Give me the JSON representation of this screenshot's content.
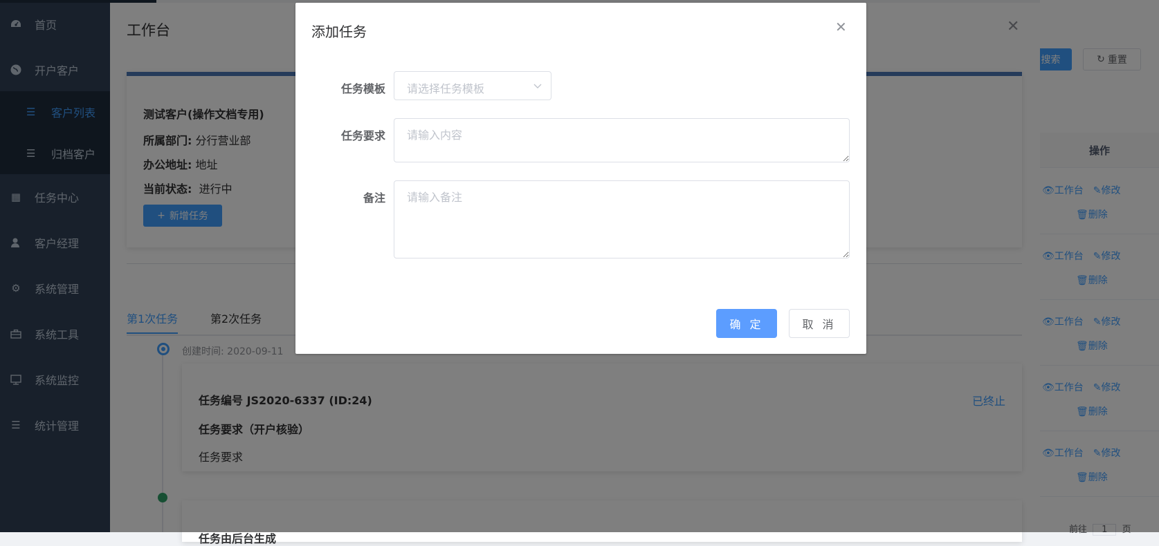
{
  "sidebar": {
    "items": [
      {
        "label": "首页",
        "icon": "dashboard-icon"
      },
      {
        "label": "开户客户",
        "icon": "globe-icon"
      },
      {
        "label": "任务中心",
        "icon": "grid-icon"
      },
      {
        "label": "客户经理",
        "icon": "user-icon"
      },
      {
        "label": "系统管理",
        "icon": "gear-icon"
      },
      {
        "label": "系统工具",
        "icon": "toolbox-icon"
      },
      {
        "label": "系统监控",
        "icon": "monitor-icon"
      },
      {
        "label": "统计管理",
        "icon": "list-icon"
      }
    ],
    "subitems": [
      {
        "label": "客户列表",
        "active": true
      },
      {
        "label": "归档客户",
        "active": false
      }
    ]
  },
  "background_page": {
    "search_label": "搜索",
    "reset_label": "重置",
    "table_header_ops": "操作",
    "row_actions": {
      "workbench": "工作台",
      "edit": "修改",
      "delete": "删除"
    },
    "pager_goto": "前往",
    "pager_value": "1",
    "pager_unit": "页"
  },
  "drawer": {
    "title": "工作台",
    "customer_name": "测试客户(操作文档专用)",
    "dept_label": "所属部门:",
    "dept_value": "分行营业部",
    "address_label": "办公地址:",
    "address_value": "地址",
    "status_label": "当前状态:",
    "status_value": "进行中",
    "add_task_label": "新增任务",
    "tabs": [
      "第1次任务",
      "第2次任务"
    ],
    "created_time": "创建时间:  2020-09-11",
    "task": {
      "number": "任务编号 JS2020-6337 (ID:24)",
      "requirement_title": "任务要求（开户核验）",
      "requirement": "任务要求",
      "status": "已终止"
    },
    "task2_title": "任务由后台生成"
  },
  "dialog": {
    "title": "添加任务",
    "template_label": "任务模板",
    "template_placeholder": "请选择任务模板",
    "requirement_label": "任务要求",
    "requirement_placeholder": "请输入内容",
    "remark_label": "备注",
    "remark_placeholder": "请输入备注",
    "confirm_label": "确 定",
    "cancel_label": "取 消"
  },
  "colors": {
    "primary": "#409eff",
    "sidebar_bg": "#304156",
    "sidebar_sub_bg": "#1f2d3d",
    "overlay": "rgba(0,0,0,0.5)"
  }
}
